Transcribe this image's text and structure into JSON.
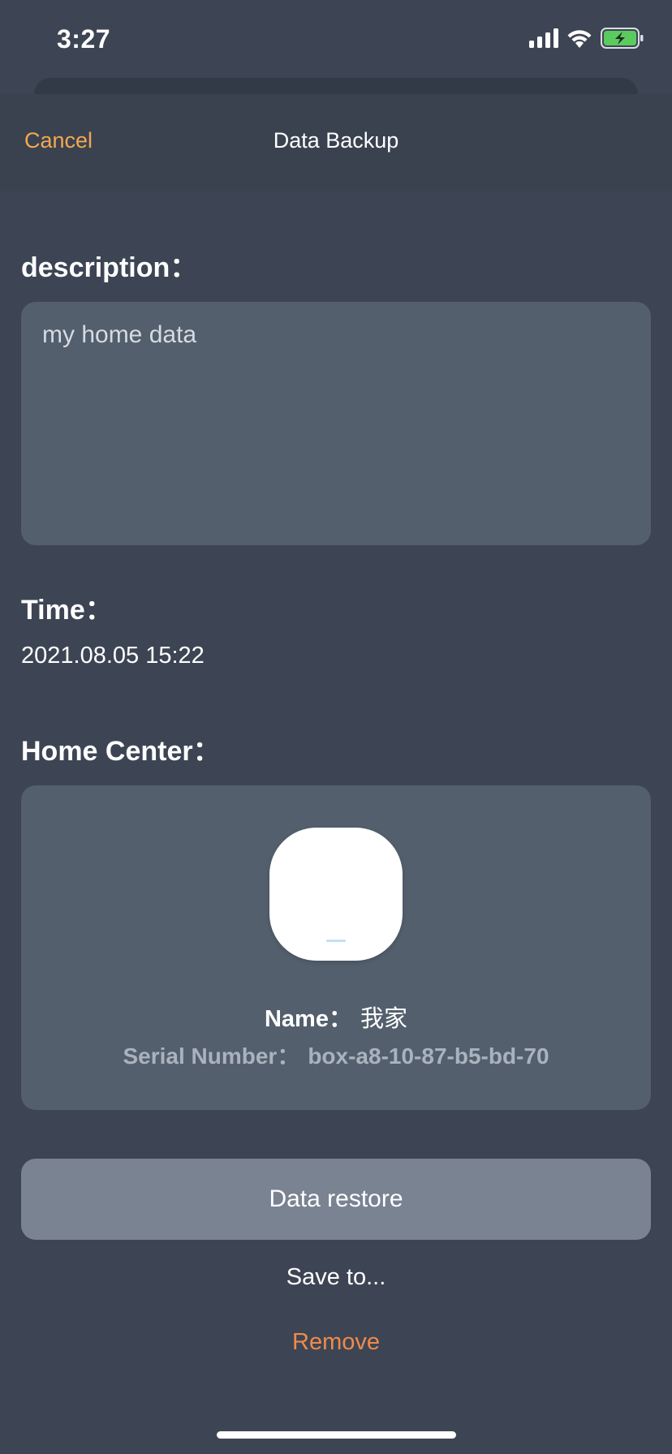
{
  "status_bar": {
    "time": "3:27",
    "icons": [
      "cellular-signal-icon",
      "wifi-icon",
      "battery-charging-icon"
    ],
    "battery_color": "#5ccb5f"
  },
  "nav": {
    "cancel_label": "Cancel",
    "title": "Data Backup"
  },
  "description": {
    "label": "description：",
    "value": "my home data"
  },
  "time": {
    "label": "Time：",
    "value": "2021.08.05 15:22"
  },
  "home_center": {
    "label": "Home Center：",
    "device_icon": "home-center-hub-icon",
    "name_label": "Name：",
    "name_value": "我家",
    "serial_label": "Serial Number：",
    "serial_value": "box-a8-10-87-b5-bd-70"
  },
  "actions": {
    "restore_label": "Data restore",
    "save_label": "Save to...",
    "remove_label": "Remove"
  },
  "colors": {
    "background": "#3d4554",
    "card": "#535f6d",
    "accent_cancel": "#f2a84f",
    "accent_remove": "#ef8a4a",
    "button": "#7a8392"
  }
}
